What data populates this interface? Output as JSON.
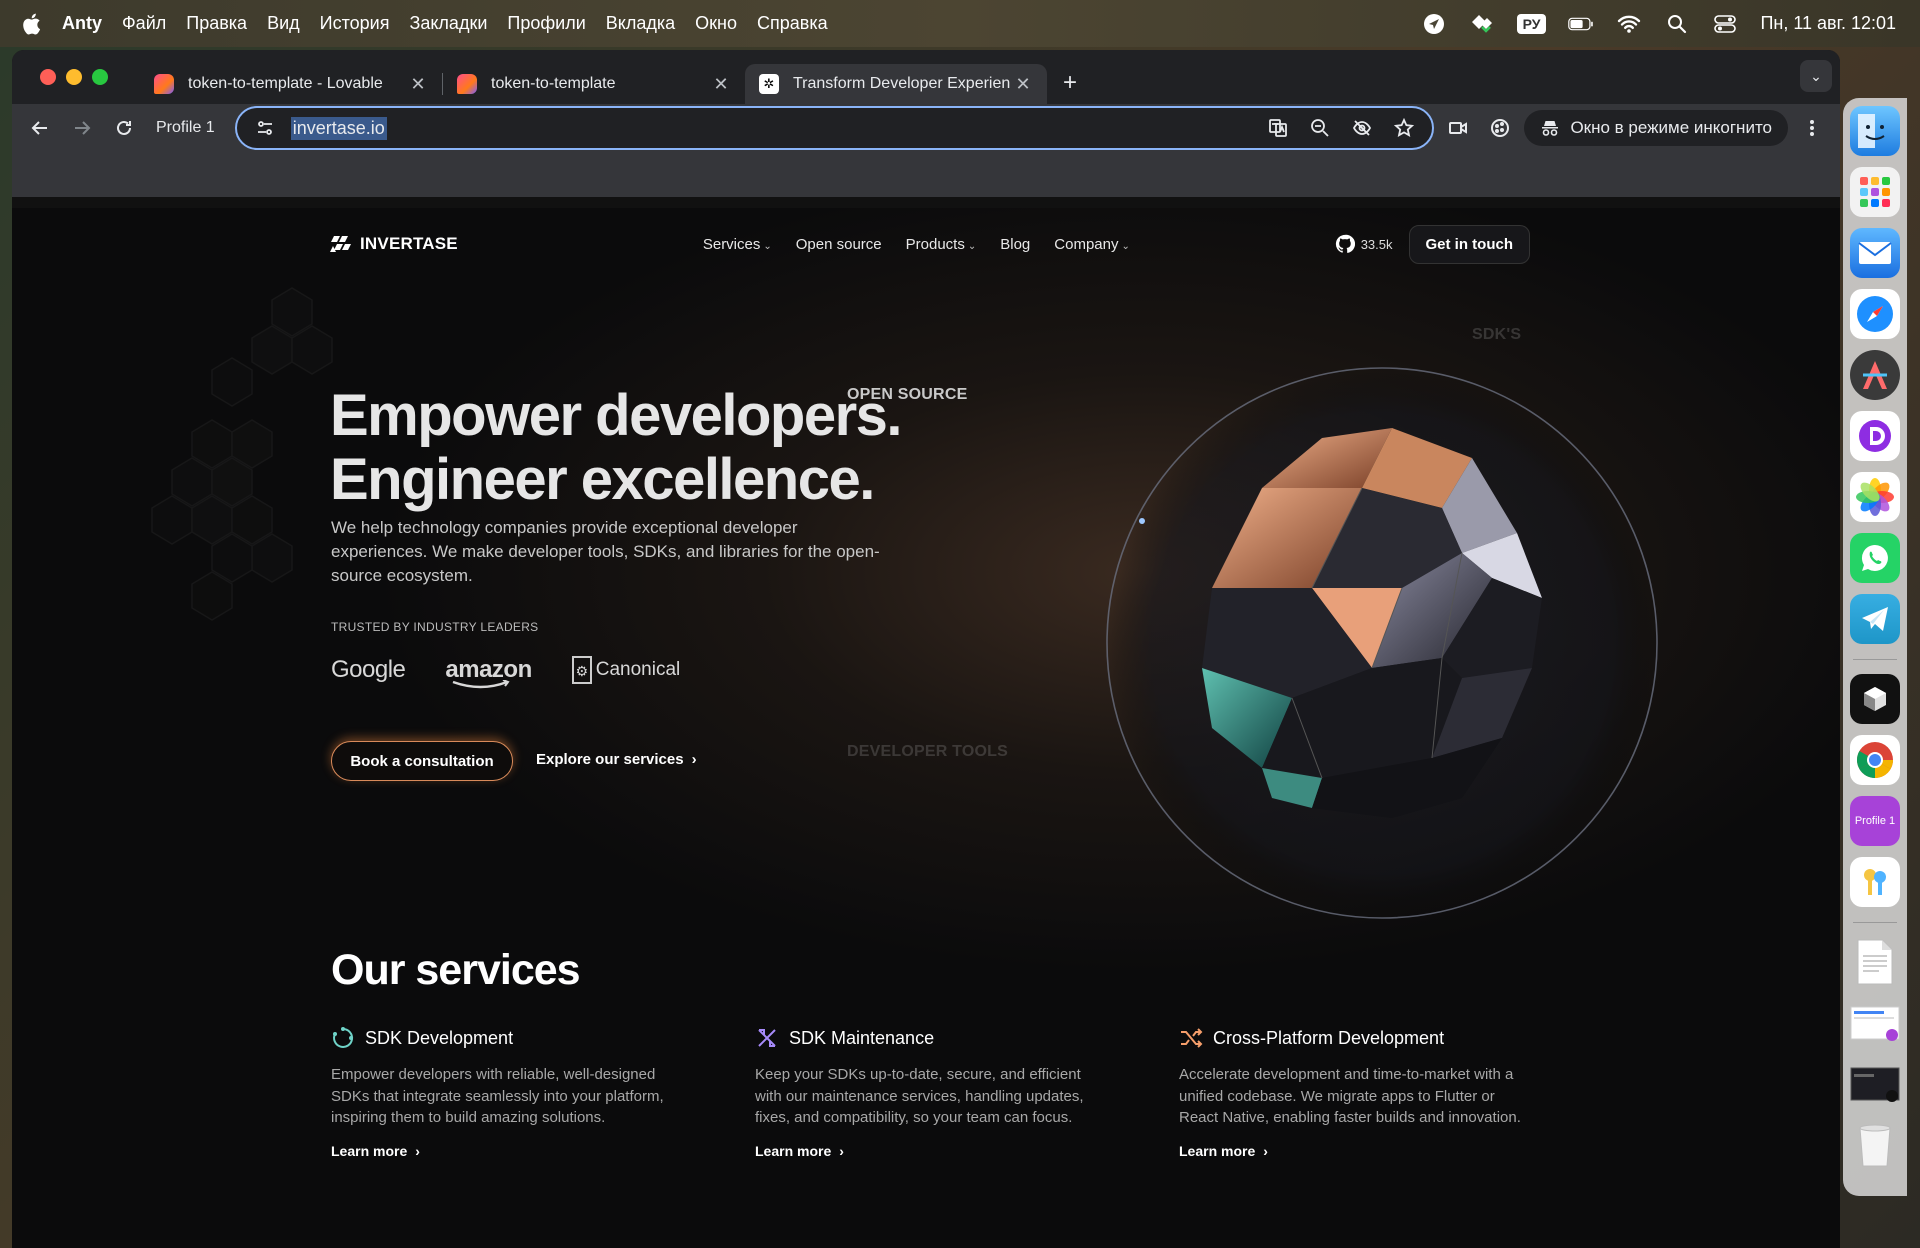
{
  "menubar": {
    "app_name": "Anty",
    "items": [
      "Файл",
      "Правка",
      "Вид",
      "История",
      "Закладки",
      "Профили",
      "Вкладка",
      "Окно",
      "Справка"
    ],
    "input_lang": "РУ",
    "datetime": "Пн, 11 авг. 12:01"
  },
  "browser": {
    "tabs": [
      {
        "title": "token-to-template - Lovable",
        "favicon": "lovable-icon",
        "active": false
      },
      {
        "title": "token-to-template",
        "favicon": "lovable-icon",
        "active": false
      },
      {
        "title": "Transform Developer Experien",
        "favicon": "invertase-icon",
        "active": true
      }
    ],
    "profile_label": "Profile 1",
    "url": "invertase.io",
    "incognito_label": "Окно в режиме инкогнито"
  },
  "site": {
    "logo_text": "INVERTASE",
    "nav": {
      "services": "Services",
      "open_source": "Open source",
      "products": "Products",
      "blog": "Blog",
      "company": "Company",
      "github_stars": "33.5k",
      "cta": "Get in touch"
    },
    "hero": {
      "title_line1": "Empower developers.",
      "title_line2": "Engineer excellence.",
      "subtitle": "We help technology companies provide exceptional developer experiences. We make developer tools, SDKs, and libraries for the open-source ecosystem.",
      "trusted_label": "TRUSTED BY INDUSTRY LEADERS",
      "brands": [
        "Google",
        "amazon",
        "Canonical"
      ],
      "primary_cta": "Book a consultation",
      "secondary_cta": "Explore our services"
    },
    "orb_labels": {
      "top": "SDK'S",
      "left": "OPEN SOURCE",
      "bottom": "DEVELOPER TOOLS"
    },
    "services": {
      "title": "Our services",
      "items": [
        {
          "title": "SDK Development",
          "icon": "sdk-cycle-icon",
          "desc": "Empower developers with reliable, well-designed SDKs that integrate seamlessly into your platform, inspiring them to build amazing solutions.",
          "link": "Learn more"
        },
        {
          "title": "SDK Maintenance",
          "icon": "tools-icon",
          "desc": "Keep your SDKs up-to-date, secure, and efficient with our maintenance services, handling updates, fixes, and compatibility, so your team can focus.",
          "link": "Learn more"
        },
        {
          "title": "Cross-Platform Development",
          "icon": "shuffle-icon",
          "desc": "Accelerate development and time-to-market with a unified codebase. We migrate apps to Flutter or React Native, enabling faster builds and innovation.",
          "link": "Learn more"
        }
      ]
    }
  },
  "dock": {
    "profile_badge": "Profile 1",
    "items": [
      "finder-icon",
      "launchpad-icon",
      "mail-icon",
      "safari-icon",
      "vectorize-icon",
      "dash-icon",
      "photos-icon",
      "whatsapp-icon",
      "telegram-icon",
      "cube-app-icon",
      "chrome-icon",
      "profile-icon",
      "keychain-icon",
      "txt-file-icon",
      "screenshot-icon",
      "screenshot-dark-icon",
      "trash-icon"
    ]
  }
}
